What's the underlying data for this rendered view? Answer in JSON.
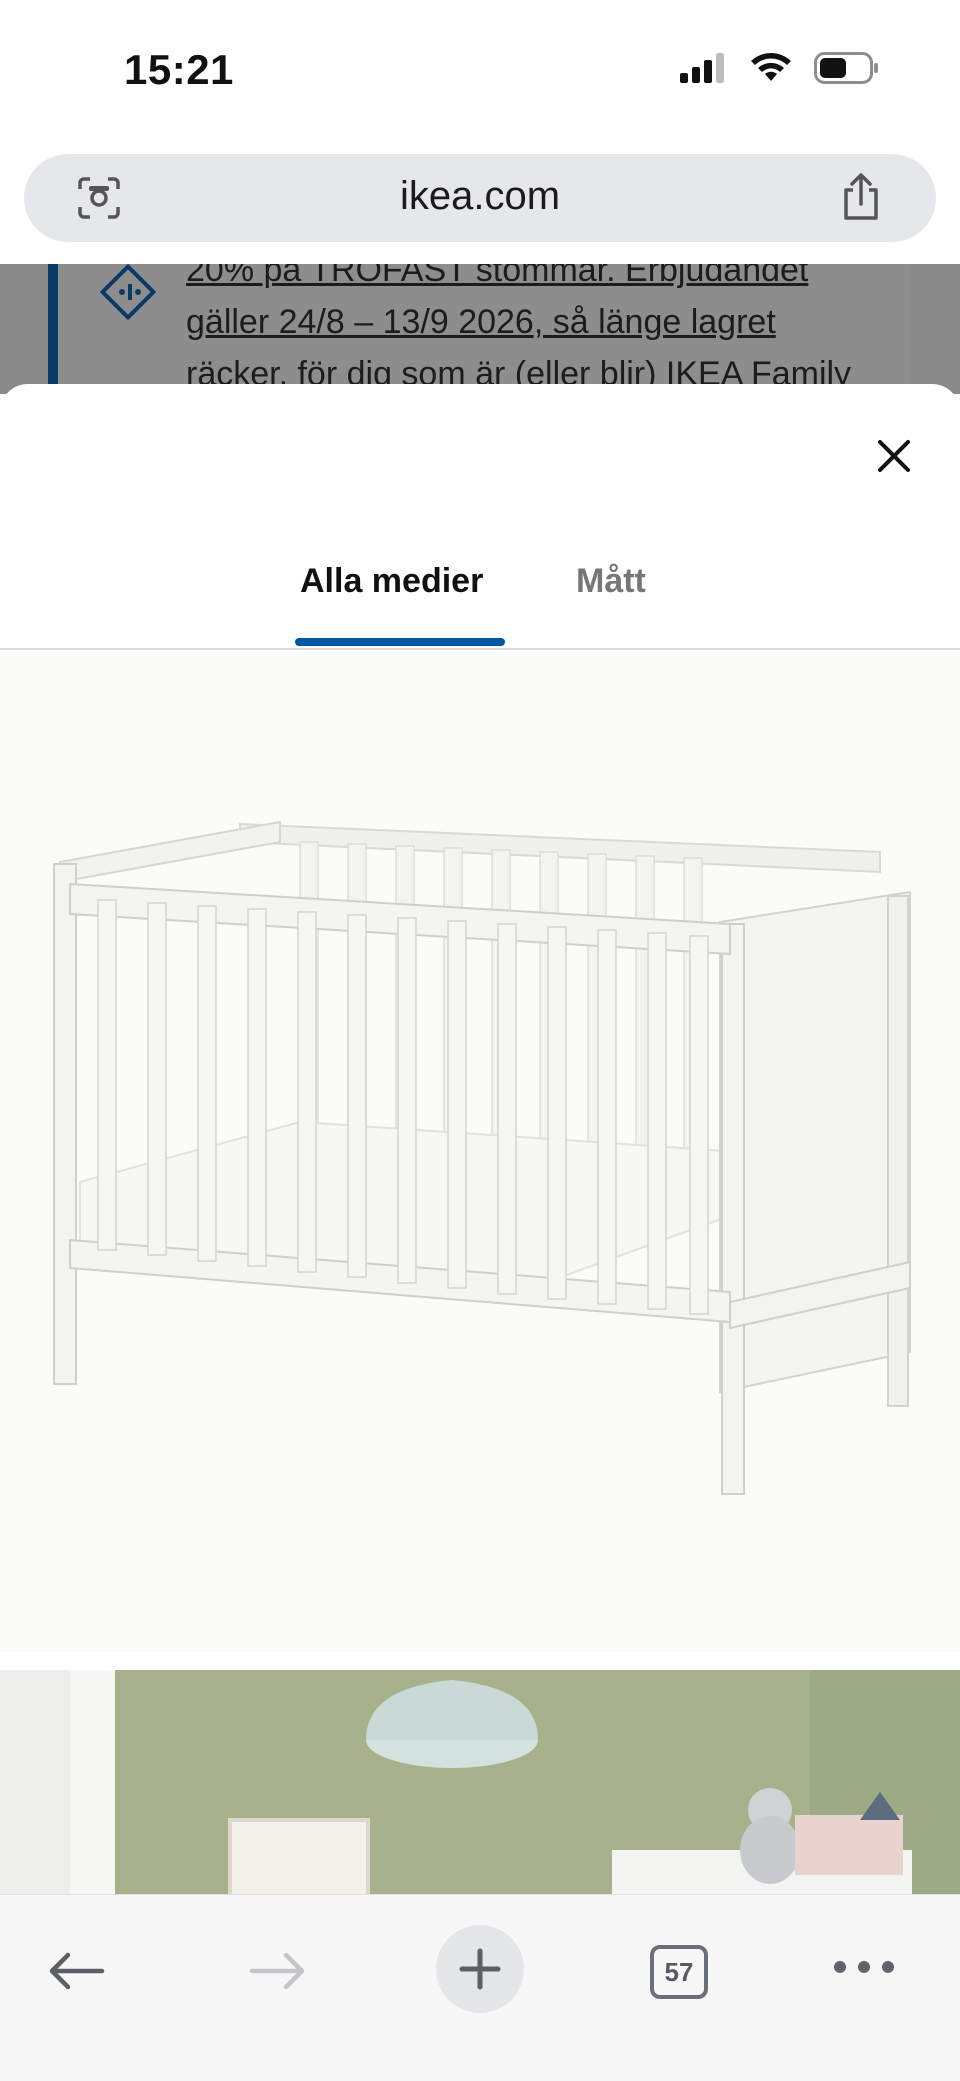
{
  "status_bar": {
    "time": "15:21"
  },
  "browser": {
    "url": "ikea.com"
  },
  "background_page": {
    "banner_lines": [
      "20% på TROFAST stommar. Erbjudandet",
      "gäller 24/8 – 13/9 2026, så länge lagret",
      "räcker, för dig som är (eller blir) IKEA Family"
    ]
  },
  "media_sheet": {
    "tabs": [
      {
        "label": "Alla medier",
        "selected": true
      },
      {
        "label": "Mått",
        "selected": false
      }
    ]
  },
  "toolbar": {
    "tab_count": "57"
  },
  "colors": {
    "accent": "#0058a3",
    "ikea_blue": "#0a3a66"
  }
}
